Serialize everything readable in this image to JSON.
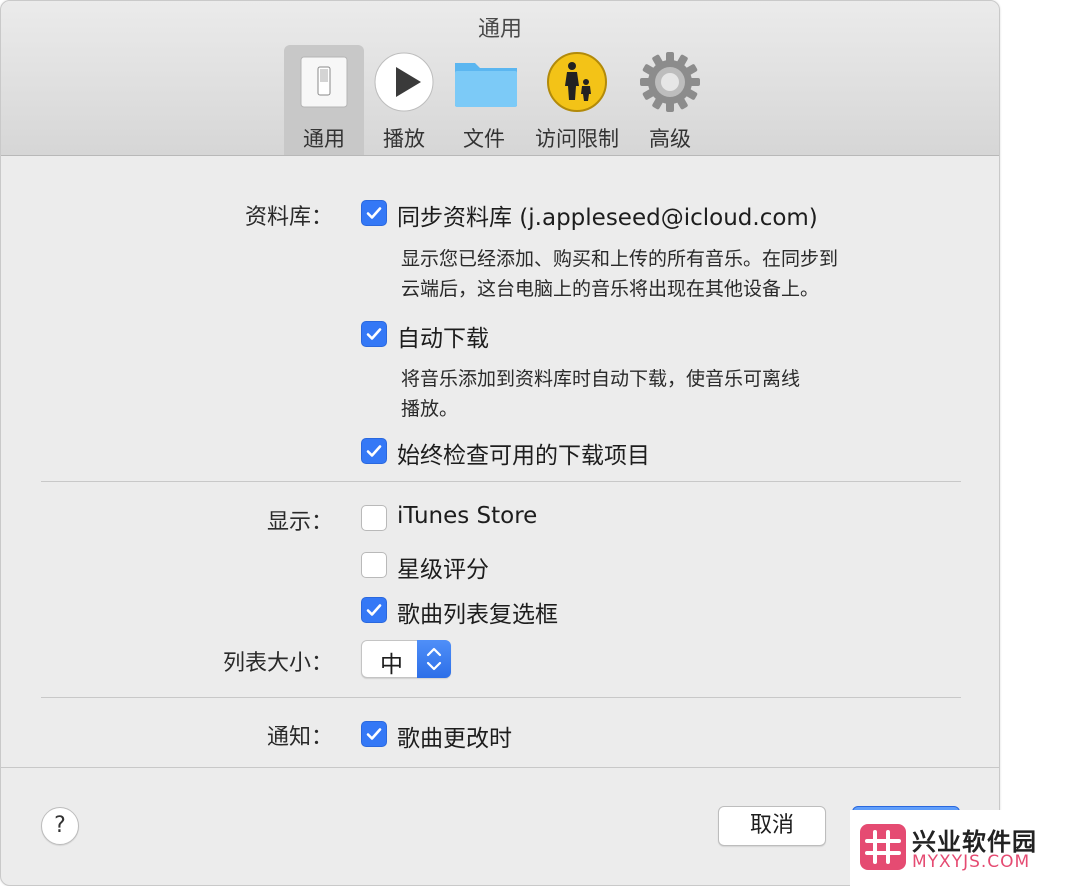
{
  "window": {
    "title": "通用"
  },
  "tabs": [
    {
      "label": "通用",
      "icon": "general-switch-icon",
      "selected": true
    },
    {
      "label": "播放",
      "icon": "play-icon"
    },
    {
      "label": "文件",
      "icon": "folder-icon"
    },
    {
      "label": "访问限制",
      "icon": "parental-controls-icon"
    },
    {
      "label": "高级",
      "icon": "gear-icon"
    }
  ],
  "library": {
    "label": "资料库：",
    "sync": {
      "text": "同步资料库 (j.appleseed@icloud.com)",
      "checked": true
    },
    "sync_desc_line1": "显示您已经添加、购买和上传的所有音乐。在同步到",
    "sync_desc_line2": "云端后，这台电脑上的音乐将出现在其他设备上。",
    "auto_download": {
      "text": "自动下载",
      "checked": true
    },
    "auto_desc_line1": "将音乐添加到资料库时自动下载，使音乐可离线",
    "auto_desc_line2": "播放。",
    "check_downloads": {
      "text": "始终检查可用的下载项目",
      "checked": true
    }
  },
  "display": {
    "label": "显示：",
    "itunes_store": {
      "text": "iTunes Store",
      "checked": false
    },
    "star_ratings": {
      "text": "星级评分",
      "checked": false
    },
    "song_checkboxes": {
      "text": "歌曲列表复选框",
      "checked": true
    }
  },
  "list_size": {
    "label": "列表大小：",
    "value": "中"
  },
  "notifications": {
    "label": "通知：",
    "song_changes": {
      "text": "歌曲更改时",
      "checked": true
    }
  },
  "footer": {
    "help": "?",
    "cancel": "取消"
  },
  "watermark": {
    "title": "兴业软件园",
    "subtitle": "MYXYJS.COM"
  },
  "colors": {
    "accent": "#3478f6",
    "watermark": "#e54b72"
  }
}
